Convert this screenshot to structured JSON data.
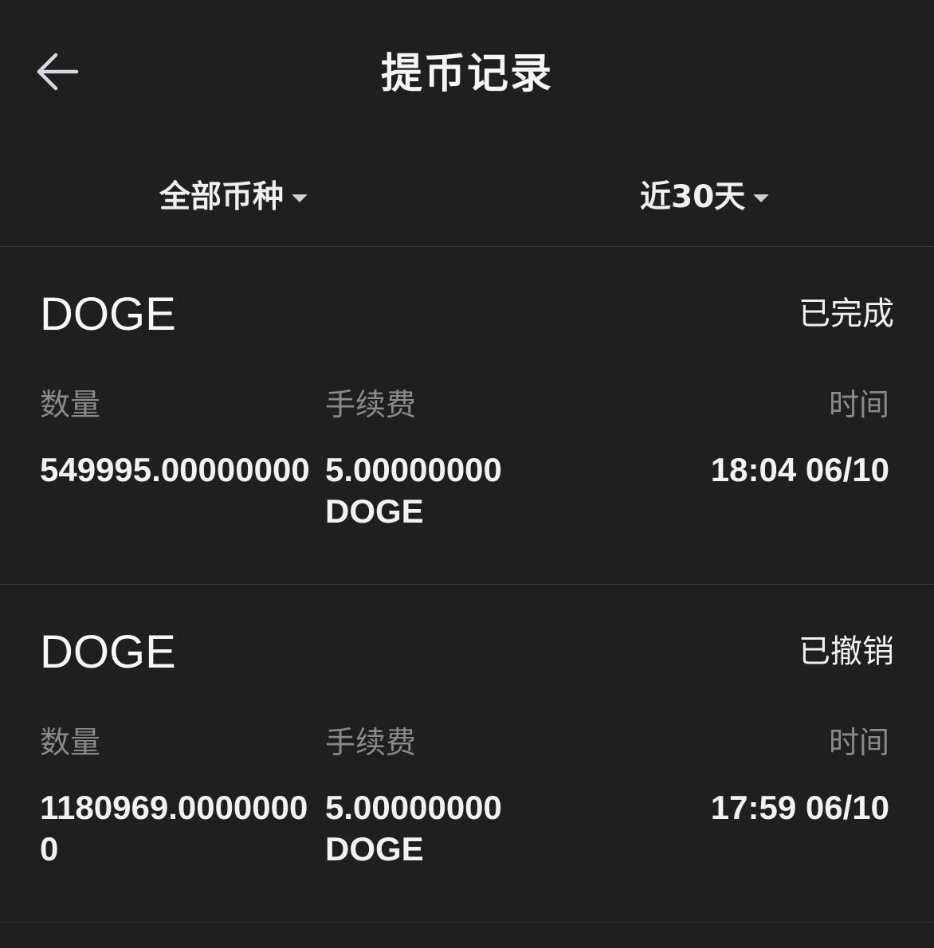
{
  "header": {
    "title": "提币记录",
    "back_icon": "arrow-left-icon"
  },
  "filters": {
    "currency": "全部币种",
    "period": "近30天"
  },
  "labels": {
    "amount": "数量",
    "fee": "手续费",
    "time": "时间"
  },
  "records": [
    {
      "coin": "DOGE",
      "status": "已完成",
      "amount": "549995.00000000",
      "fee_value": "5.00000000",
      "fee_unit": "DOGE",
      "time": "18:04 06/10"
    },
    {
      "coin": "DOGE",
      "status": "已撤销",
      "amount": "1180969.00000000",
      "fee_value": "5.00000000",
      "fee_unit": "DOGE",
      "time": "17:59 06/10"
    }
  ],
  "colors": {
    "background": "#1f1f1f",
    "label": "#8a8a8a",
    "text": "#f2f2f2"
  }
}
